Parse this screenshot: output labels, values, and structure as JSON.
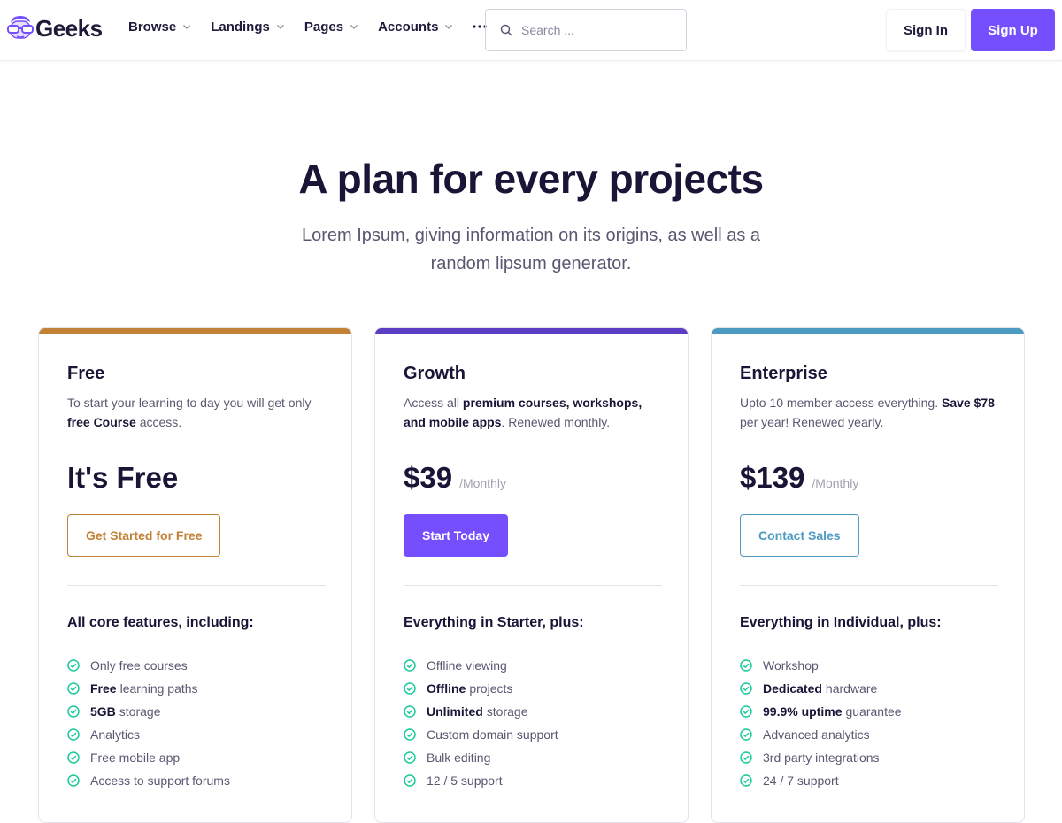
{
  "colors": {
    "primary": "#754ffe",
    "free_accent": "#c28135",
    "growth_accent": "#5b3ec4",
    "enterprise_accent": "#4d9bc2",
    "check": "#19cb98"
  },
  "navbar": {
    "brand": "Geeks",
    "menu": [
      {
        "label": "Browse"
      },
      {
        "label": "Landings"
      },
      {
        "label": "Pages"
      },
      {
        "label": "Accounts"
      }
    ],
    "search_placeholder": "Search ...",
    "sign_in": "Sign In",
    "sign_up": "Sign Up"
  },
  "hero": {
    "title": "A plan for every projects",
    "subtitle": "Lorem Ipsum, giving information on its origins, as well as a random lipsum generator."
  },
  "plans": [
    {
      "name": "Free",
      "desc": [
        {
          "text": "To start your learning to day you will get only ",
          "bold": false
        },
        {
          "text": "free Course",
          "bold": true
        },
        {
          "text": " access.",
          "bold": false
        }
      ],
      "price": "It's Free",
      "period": "",
      "cta": "Get Started for Free",
      "features_title": "All core features, including:",
      "features": [
        {
          "bold": "",
          "text": "Only free courses"
        },
        {
          "bold": "Free",
          "text": "learning paths"
        },
        {
          "bold": "5GB",
          "text": "storage"
        },
        {
          "bold": "",
          "text": "Analytics"
        },
        {
          "bold": "",
          "text": "Free mobile app"
        },
        {
          "bold": "",
          "text": "Access to support forums"
        }
      ]
    },
    {
      "name": "Growth",
      "desc": [
        {
          "text": "Access all ",
          "bold": false
        },
        {
          "text": "premium courses, workshops, and mobile apps",
          "bold": true
        },
        {
          "text": ". Renewed monthly.",
          "bold": false
        }
      ],
      "price": "$39",
      "period": "/Monthly",
      "cta": "Start Today",
      "features_title": "Everything in Starter, plus:",
      "features": [
        {
          "bold": "",
          "text": "Offline viewing"
        },
        {
          "bold": "Offline",
          "text": "projects"
        },
        {
          "bold": "Unlimited",
          "text": "storage"
        },
        {
          "bold": "",
          "text": "Custom domain support"
        },
        {
          "bold": "",
          "text": "Bulk editing"
        },
        {
          "bold": "",
          "text": "12 / 5 support"
        }
      ]
    },
    {
      "name": "Enterprise",
      "desc": [
        {
          "text": "Upto 10 member access everything. ",
          "bold": false
        },
        {
          "text": "Save $78",
          "bold": true
        },
        {
          "text": " per year! Renewed yearly.",
          "bold": false
        }
      ],
      "price": "$139",
      "period": "/Monthly",
      "cta": "Contact Sales",
      "features_title": "Everything in Individual, plus:",
      "features": [
        {
          "bold": "",
          "text": "Workshop"
        },
        {
          "bold": "Dedicated",
          "text": "hardware"
        },
        {
          "bold": "99.9% uptime",
          "text": "guarantee"
        },
        {
          "bold": "",
          "text": "Advanced analytics"
        },
        {
          "bold": "",
          "text": "3rd party integrations"
        },
        {
          "bold": "",
          "text": "24 / 7 support"
        }
      ]
    }
  ]
}
